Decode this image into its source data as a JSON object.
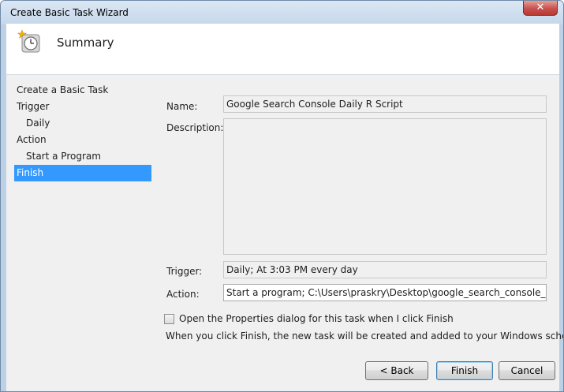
{
  "window": {
    "title": "Create Basic Task Wizard",
    "close_label": "✕"
  },
  "header": {
    "title": "Summary",
    "icon": "clock-star-icon"
  },
  "nav": {
    "items": [
      {
        "label": "Create a Basic Task",
        "level": 0,
        "active": false
      },
      {
        "label": "Trigger",
        "level": 0,
        "active": false
      },
      {
        "label": "Daily",
        "level": 1,
        "active": false
      },
      {
        "label": "Action",
        "level": 0,
        "active": false
      },
      {
        "label": "Start a Program",
        "level": 1,
        "active": false
      },
      {
        "label": "Finish",
        "level": 0,
        "active": true
      }
    ]
  },
  "summary": {
    "name_label": "Name:",
    "name_value": "Google Search Console Daily R Script",
    "description_label": "Description:",
    "description_value": "",
    "trigger_label": "Trigger:",
    "trigger_value": "Daily; At 3:03 PM every day",
    "action_label": "Action:",
    "action_value": "Start a program; C:\\Users\\praskry\\Desktop\\google_search_console_daily_R\\sc"
  },
  "options": {
    "open_properties_label": "Open the Properties dialog for this task when I click Finish",
    "open_properties_checked": false,
    "hint": "When you click Finish, the new task will be created and added to your Windows schedule."
  },
  "buttons": {
    "back": "< Back",
    "finish": "Finish",
    "cancel": "Cancel"
  }
}
